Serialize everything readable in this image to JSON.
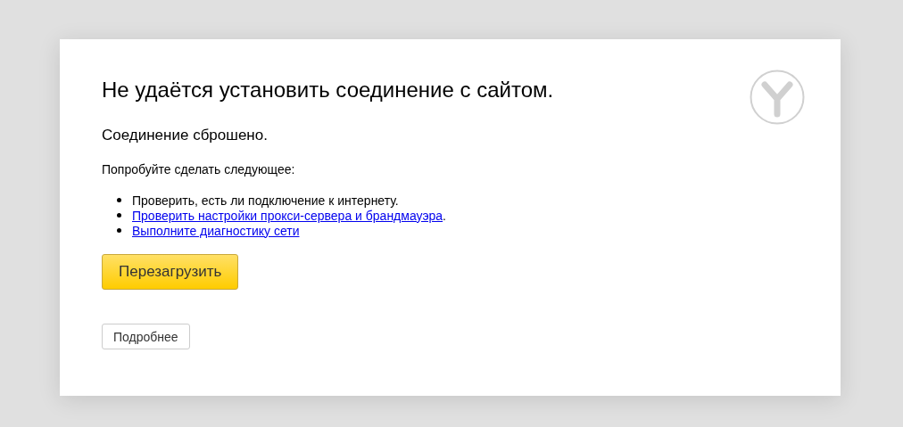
{
  "title": "Не удаётся установить соединение с сайтом.",
  "subtitle": "Соединение сброшено.",
  "hint": "Попробуйте сделать следующее:",
  "suggestions": [
    {
      "kind": "text",
      "text": "Проверить, есть ли подключение к интернету."
    },
    {
      "kind": "link",
      "link": "Проверить настройки прокси-сервера и брандмауэра",
      "suffix": "."
    },
    {
      "kind": "link",
      "link": "Выполните диагностику сети"
    }
  ],
  "reload_button": "Перезагрузить",
  "details_button": "Подробнее"
}
